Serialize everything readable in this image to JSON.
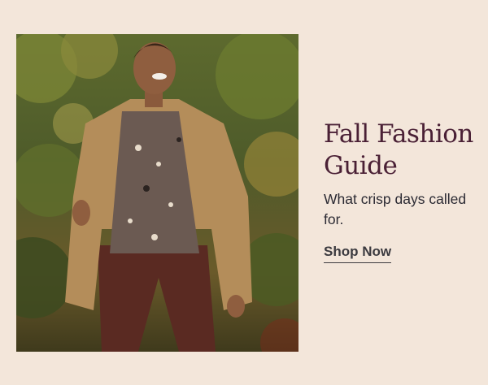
{
  "promo": {
    "headline_line1": "Fall Fashion",
    "headline_line2": "Guide",
    "subheadline": "What crisp days called for.",
    "cta_label": "Shop Now"
  },
  "colors": {
    "background": "#f3e6da",
    "headline": "#4a2035",
    "body_text": "#2b2a33"
  }
}
